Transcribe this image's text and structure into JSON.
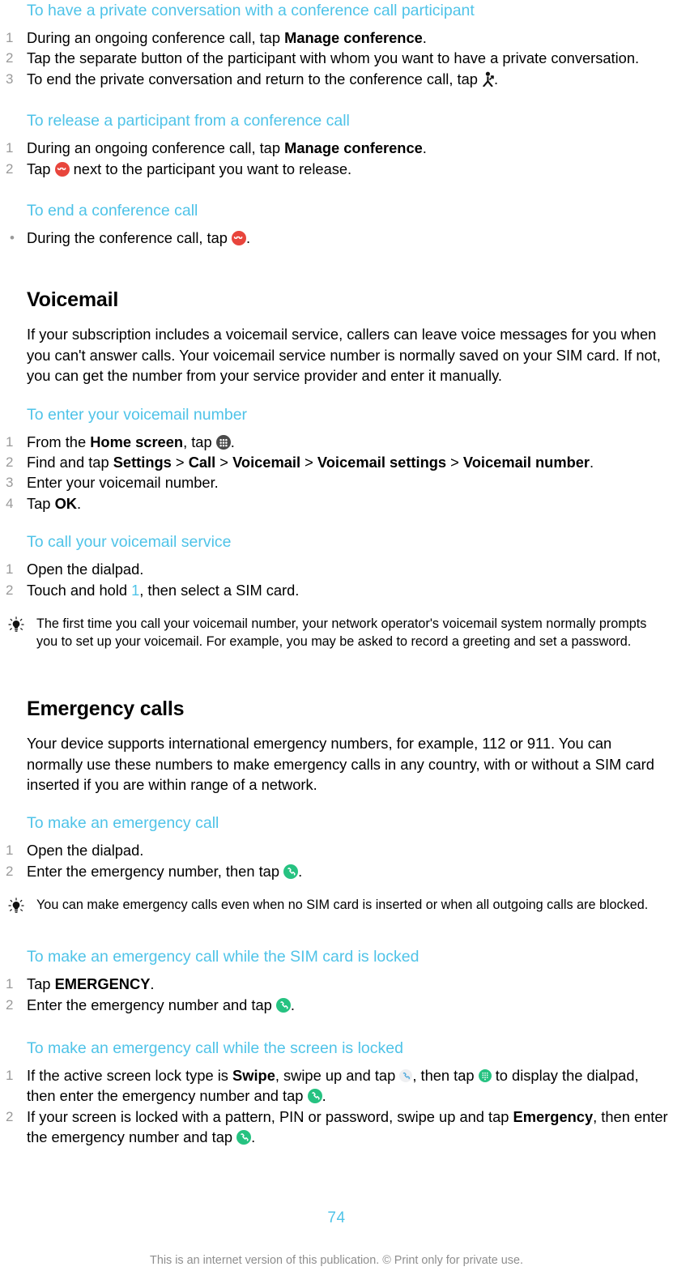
{
  "document": {
    "page_number": "74",
    "footer_note": "This is an internet version of this publication. © Print only for private use.",
    "accent_color": "#4FC3E8",
    "end_call_color": "#E8453C",
    "call_color": "#26C281",
    "drawer_color": "#4a4a4a"
  },
  "sections": [
    {
      "id": "private-conversation",
      "heading": "To have a private conversation with a conference call participant",
      "steps": [
        {
          "num": "1",
          "pre": "During an ongoing conference call, tap ",
          "bold": "Manage conference",
          "post": ".",
          "icon": ""
        },
        {
          "num": "2",
          "pre": "Tap the separate button of the participant with whom you want to have a private conversation.",
          "bold": "",
          "post": "",
          "icon": ""
        },
        {
          "num": "3",
          "pre": "To end the private conversation and return to the conference call, tap ",
          "bold": "",
          "post": ".",
          "icon": "merge-call-icon"
        }
      ]
    },
    {
      "id": "release-participant",
      "heading": "To release a participant from a conference call",
      "steps": [
        {
          "num": "1",
          "pre": "During an ongoing conference call, tap ",
          "bold": "Manage conference",
          "post": ".",
          "icon": ""
        },
        {
          "num": "2",
          "pre": "Tap ",
          "bold": "",
          "post": " next to the participant you want to release.",
          "icon": "end-call-icon"
        }
      ]
    },
    {
      "id": "end-conference",
      "heading": "To end a conference call",
      "bullets": [
        {
          "bullet": "•",
          "pre": "During the conference call, tap ",
          "post": ".",
          "icon": "end-call-icon"
        }
      ]
    }
  ],
  "voicemail": {
    "title": "Voicemail",
    "intro": "If your subscription includes a voicemail service, callers can leave voice messages for you when you can't answer calls. Your voicemail service number is normally saved on your SIM card. If not, you can get the number from your service provider and enter it manually.",
    "enter_number": {
      "heading": "To enter your voicemail number",
      "steps": [
        {
          "num": "1",
          "pre": "From the ",
          "bold": "Home screen",
          "mid": ", tap ",
          "post": ".",
          "icon": "app-drawer-icon"
        },
        {
          "num": "2",
          "segments": [
            {
              "text": "Find and tap ",
              "style": "normal"
            },
            {
              "text": "Settings",
              "style": "bold"
            },
            {
              "text": " > ",
              "style": "normal"
            },
            {
              "text": "Call",
              "style": "bold"
            },
            {
              "text": " > ",
              "style": "normal"
            },
            {
              "text": "Voicemail",
              "style": "bold"
            },
            {
              "text": " > ",
              "style": "normal"
            },
            {
              "text": "Voicemail settings",
              "style": "bold"
            },
            {
              "text": " > ",
              "style": "normal"
            },
            {
              "text": "Voicemail number",
              "style": "bold"
            },
            {
              "text": ".",
              "style": "normal"
            }
          ]
        },
        {
          "num": "3",
          "pre": "Enter your voicemail number.",
          "bold": "",
          "post": ""
        },
        {
          "num": "4",
          "pre": "Tap ",
          "bold": "OK",
          "post": "."
        }
      ]
    },
    "call_service": {
      "heading": "To call your voicemail service",
      "steps": [
        {
          "num": "1",
          "pre": "Open the dialpad.",
          "bold": "",
          "post": ""
        },
        {
          "num": "2",
          "pre": "Touch and hold ",
          "blue": "1",
          "post": ", then select a SIM card."
        }
      ],
      "tip": "The first time you call your voicemail number, your network operator's voicemail system normally prompts you to set up your voicemail. For example, you may be asked to record a greeting and set a password."
    }
  },
  "emergency": {
    "title": "Emergency calls",
    "intro": "Your device supports international emergency numbers, for example, 112 or 911. You can normally use these numbers to make emergency calls in any country, with or without a SIM card inserted if you are within range of a network.",
    "make_call": {
      "heading": "To make an emergency call",
      "steps": [
        {
          "num": "1",
          "pre": "Open the dialpad.",
          "post": ""
        },
        {
          "num": "2",
          "pre": "Enter the emergency number, then tap ",
          "post": ".",
          "icon": "call-icon"
        }
      ],
      "tip": "You can make emergency calls even when no SIM card is inserted or when all outgoing calls are blocked."
    },
    "sim_locked": {
      "heading": "To make an emergency call while the SIM card is locked",
      "steps": [
        {
          "num": "1",
          "pre": "Tap ",
          "bold": "EMERGENCY",
          "post": "."
        },
        {
          "num": "2",
          "pre": "Enter the emergency number and tap ",
          "post": ".",
          "icon": "call-icon"
        }
      ]
    },
    "screen_locked": {
      "heading": "To make an emergency call while the screen is locked",
      "steps": [
        {
          "num": "1",
          "p1": "If the active screen lock type is ",
          "bold": "Swipe",
          "p2": ", swipe up and tap ",
          "icon1": "phone-shortcut-icon",
          "p3": ", then tap ",
          "icon2": "dialpad-icon",
          "p4": " to display the dialpad, then enter the emergency number and tap ",
          "icon3": "call-icon",
          "p5": "."
        },
        {
          "num": "2",
          "p1": "If your screen is locked with a pattern, PIN or password, swipe up and tap ",
          "bold": "Emergency",
          "p2": ", then enter the emergency number and tap ",
          "icon1": "call-icon",
          "p3": "."
        }
      ]
    }
  }
}
